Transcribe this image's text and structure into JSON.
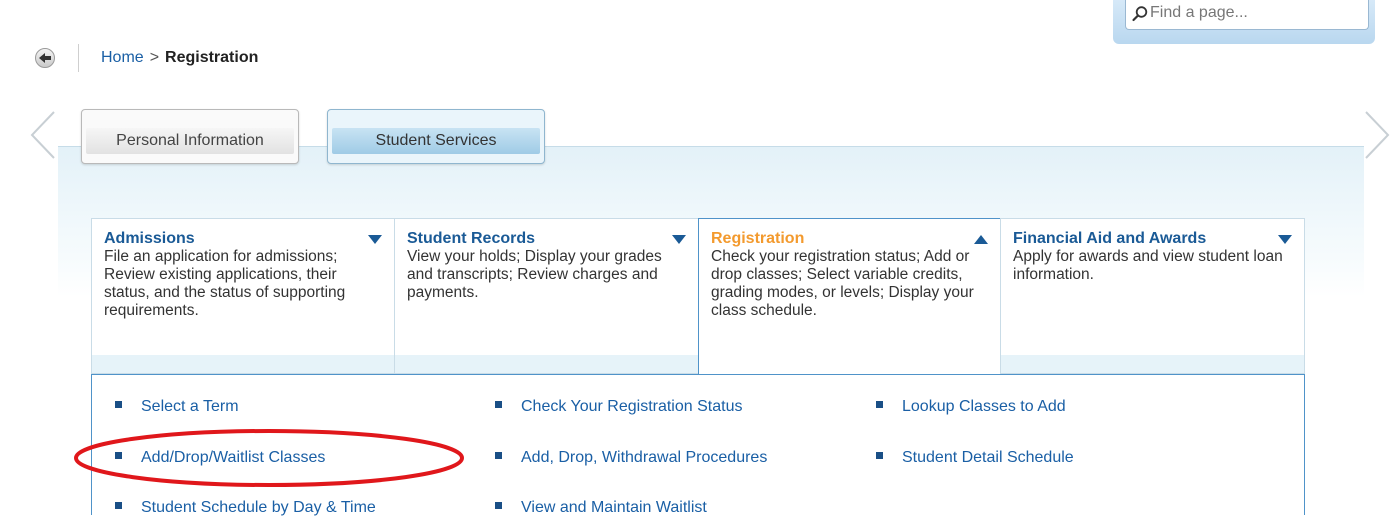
{
  "search": {
    "placeholder": "Find a page..."
  },
  "breadcrumb": {
    "home": "Home",
    "separator": ">",
    "current": "Registration"
  },
  "tabs": [
    {
      "label": "Personal Information",
      "active": false
    },
    {
      "label": "Student Services",
      "active": true
    }
  ],
  "categories": [
    {
      "title": "Admissions",
      "description": "File an application for admissions; Review existing applications, their status, and the status of supporting requirements.",
      "expanded": false
    },
    {
      "title": "Student Records",
      "description": "View your holds; Display your grades and transcripts; Review charges and payments.",
      "expanded": false
    },
    {
      "title": "Registration",
      "description": "Check your registration status; Add or drop classes; Select variable credits, grading modes, or levels; Display your class schedule.",
      "expanded": true
    },
    {
      "title": "Financial Aid and Awards",
      "description": "Apply for awards and view student loan information.",
      "expanded": false
    }
  ],
  "links": [
    "Select a Term",
    "Check Your Registration Status",
    "Lookup Classes to Add",
    "Add/Drop/Waitlist Classes",
    "Add, Drop, Withdrawal Procedures",
    "Student Detail Schedule",
    "Student Schedule by Day & Time",
    "View and Maintain Waitlist"
  ],
  "colors": {
    "link": "#1a5fa5",
    "category_title": "#1a5a96",
    "active_category_title": "#f39a2e",
    "annotation": "#e0171b"
  },
  "icons": [
    "search-icon",
    "back-arrow-icon",
    "chevron-left-icon",
    "chevron-right-icon",
    "caret-down-icon",
    "caret-up-icon",
    "bullet-icon"
  ]
}
